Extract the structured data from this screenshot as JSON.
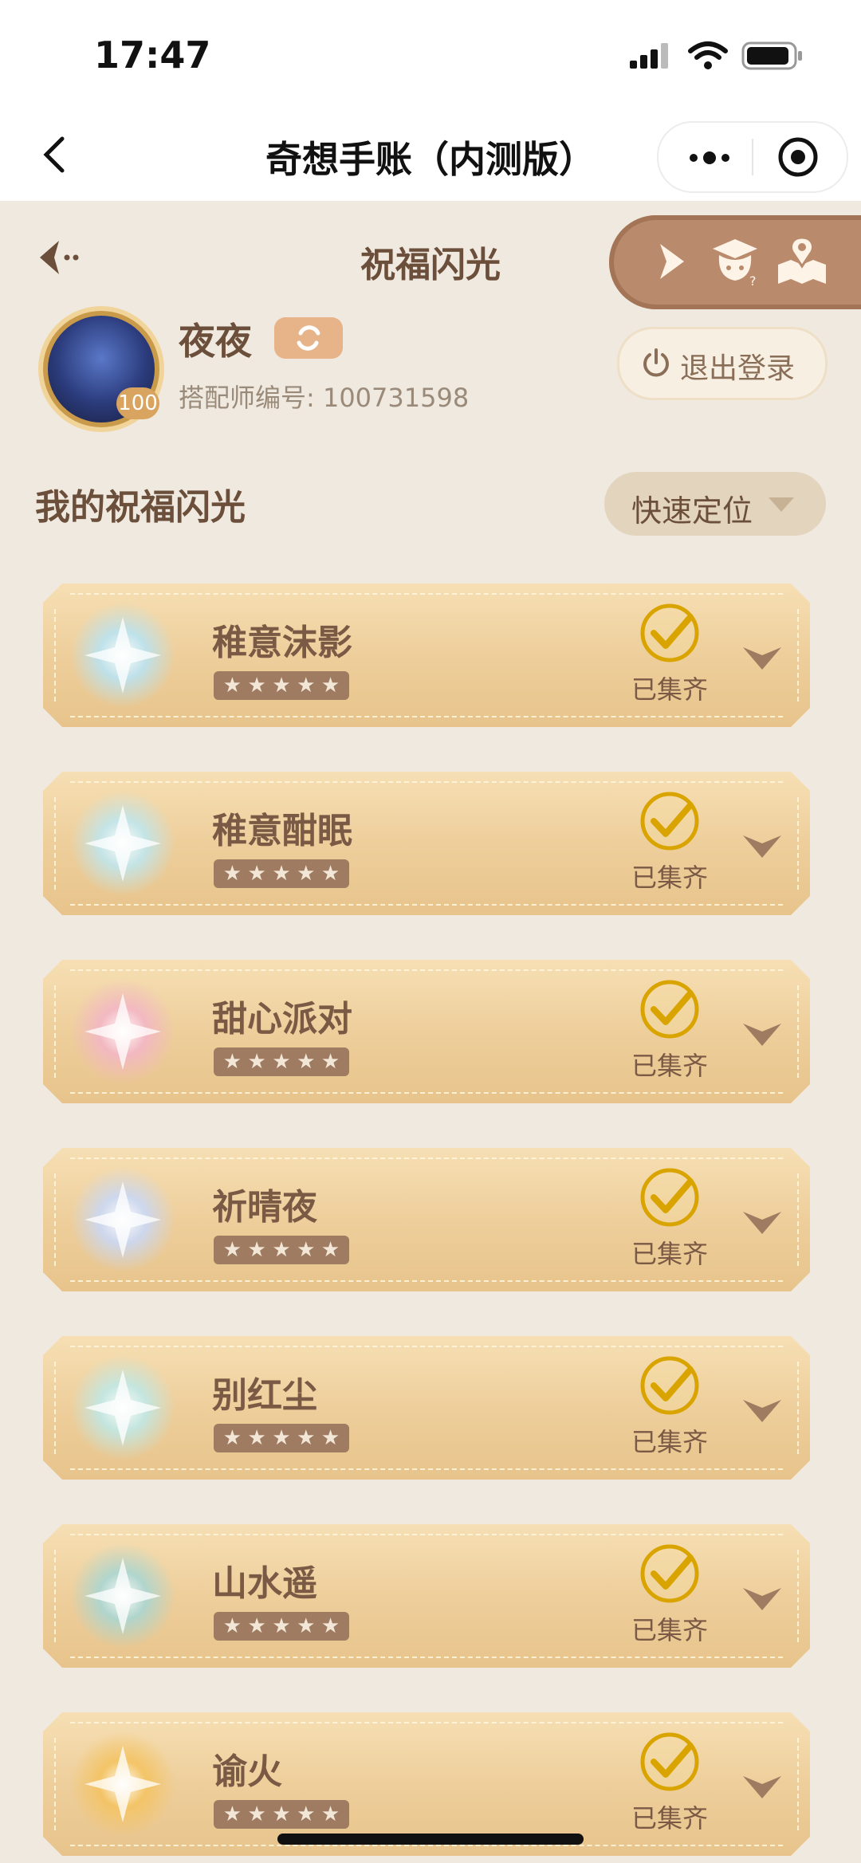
{
  "status": {
    "time": "17:47"
  },
  "nav": {
    "title": "奇想手账（内测版）"
  },
  "header": {
    "title": "祝福闪光"
  },
  "profile": {
    "nickname": "夜夜",
    "level": "100",
    "uid_label": "搭配师编号: 100731598",
    "logout_label": "退出登录"
  },
  "section": {
    "title": "我的祝福闪光",
    "quick_locate": "快速定位"
  },
  "collected_label": "已集齐",
  "items": [
    {
      "name": "稚意沫影",
      "stars": 5,
      "status": "已集齐",
      "theme": "#b9e3f2"
    },
    {
      "name": "稚意酣眠",
      "stars": 5,
      "status": "已集齐",
      "theme": "#bfe6ee"
    },
    {
      "name": "甜心派对",
      "stars": 5,
      "status": "已集齐",
      "theme": "#f3b6c6"
    },
    {
      "name": "祈晴夜",
      "stars": 5,
      "status": "已集齐",
      "theme": "#c9d8f6"
    },
    {
      "name": "别红尘",
      "stars": 5,
      "status": "已集齐",
      "theme": "#bfe8e6"
    },
    {
      "name": "山水遥",
      "stars": 5,
      "status": "已集齐",
      "theme": "#a9d6d2"
    },
    {
      "name": "谕火",
      "stars": 5,
      "status": "已集齐",
      "theme": "#f4c361"
    }
  ],
  "colors": {
    "accent": "#b98a6c",
    "check": "#d9a400",
    "text": "#6b4f3a"
  }
}
